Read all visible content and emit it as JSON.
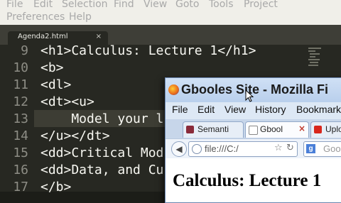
{
  "editor": {
    "menu": [
      "File",
      "Edit",
      "Selection",
      "Find",
      "View",
      "Goto",
      "Tools",
      "Project",
      "Preferences",
      "Help"
    ],
    "tab": {
      "label": "Agenda2.html",
      "close": "×"
    },
    "lines": [
      {
        "num": "9",
        "code": "<h1>Calculus: Lecture 1</h1>"
      },
      {
        "num": "10",
        "code": "<b>"
      },
      {
        "num": "11",
        "code": "<dl>"
      },
      {
        "num": "12",
        "code": "<dt><u>"
      },
      {
        "num": "13",
        "code": "    Model your l"
      },
      {
        "num": "14",
        "code": "</u></dt>"
      },
      {
        "num": "15",
        "code": "<dd>Critical Mod"
      },
      {
        "num": "16",
        "code": "<dd>Data, and Cu"
      },
      {
        "num": "17",
        "code": "</b>"
      }
    ]
  },
  "firefox": {
    "title": "Gbooles Site - Mozilla Fi",
    "menu": [
      "File",
      "Edit",
      "View",
      "History",
      "Bookmark"
    ],
    "tabs": [
      {
        "label": "Semanti",
        "icon_color": "#8a2b3a"
      },
      {
        "label": "Gbool",
        "icon_color": "#ffffff"
      },
      {
        "label": "Uplo",
        "icon_color": "#d8261c"
      }
    ],
    "url": "file:///C:/",
    "search_placeholder": "Goo",
    "search_engine_icon": "g",
    "heading": "Calculus: Lecture 1"
  },
  "colors": {
    "editor_bg": "#272822",
    "current_line": "#3d3d34",
    "firefox_frame": "#d8e4f3"
  }
}
